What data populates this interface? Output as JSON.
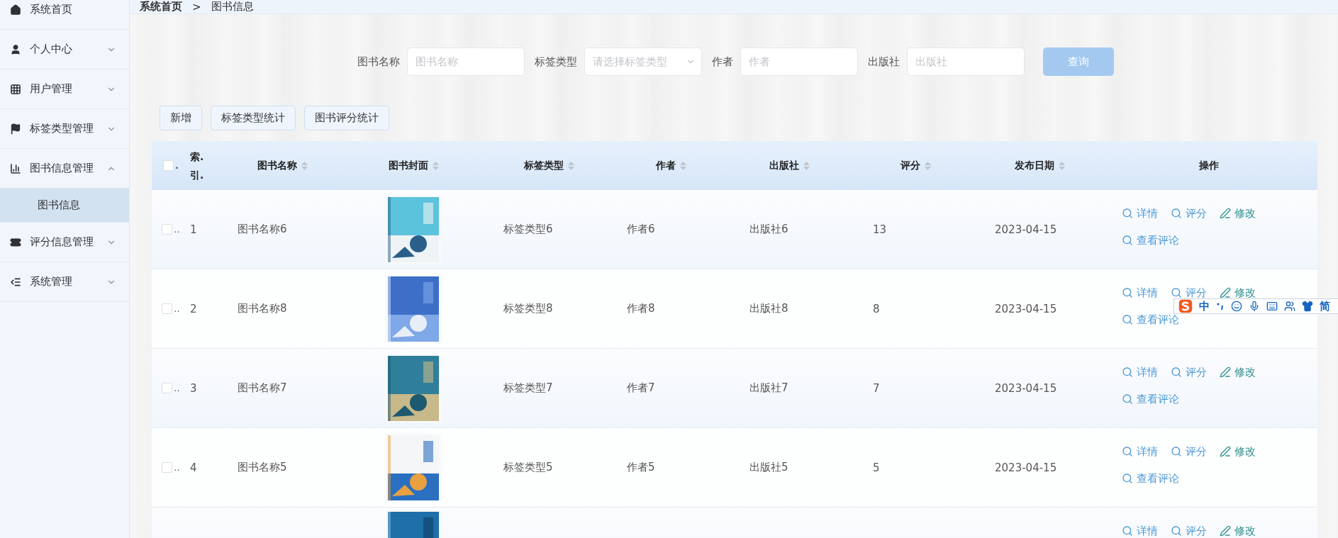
{
  "sidebar": {
    "items": [
      {
        "label": "系统首页"
      },
      {
        "label": "个人中心",
        "expanded": false
      },
      {
        "label": "用户管理",
        "expanded": false
      },
      {
        "label": "标签类型管理",
        "expanded": false
      },
      {
        "label": "图书信息管理",
        "expanded": true,
        "children": [
          {
            "label": "图书信息",
            "selected": true
          }
        ]
      },
      {
        "label": "评分信息管理",
        "expanded": false
      },
      {
        "label": "系统管理",
        "expanded": false
      }
    ]
  },
  "breadcrumb": {
    "items": [
      "系统首页",
      "图书信息"
    ],
    "separator": ">"
  },
  "search": {
    "fields": [
      {
        "kind": "input",
        "label": "图书名称",
        "placeholder": "图书名称"
      },
      {
        "kind": "select",
        "label": "标签类型",
        "placeholder": "请选择标签类型"
      },
      {
        "kind": "input",
        "label": "作者",
        "placeholder": "作者"
      },
      {
        "kind": "input",
        "label": "出版社",
        "placeholder": "出版社"
      }
    ],
    "button": {
      "label": "查询",
      "disabled": true
    }
  },
  "actions": [
    "新增",
    "标签类型统计",
    "图书评分统计"
  ],
  "table": {
    "select_all": {
      "checked": false,
      "suffix": "."
    },
    "index_header": [
      "索.",
      "引."
    ],
    "columns": [
      {
        "label": "图书名称",
        "sortable": true
      },
      {
        "label": "图书封面",
        "sortable": true
      },
      {
        "label": "标签类型",
        "sortable": true
      },
      {
        "label": "作者",
        "sortable": true
      },
      {
        "label": "出版社",
        "sortable": true
      },
      {
        "label": "评分",
        "sortable": true
      },
      {
        "label": "发布日期",
        "sortable": true
      },
      {
        "label": "操作",
        "sortable": false
      }
    ],
    "rows": [
      {
        "checked": false,
        "check_suffix": "..",
        "index": "1",
        "name": "图书名称6",
        "cover": {
          "kind": "picture"
        },
        "tag": "标签类型6",
        "author": "作者6",
        "publisher": "出版社6",
        "rating": "13",
        "date": "2023-04-15",
        "ops": [
          [
            "详情",
            "评分",
            "修改"
          ],
          [
            "查看评论"
          ]
        ]
      },
      {
        "checked": false,
        "check_suffix": "..",
        "index": "2",
        "name": "图书名称8",
        "cover": {
          "kind": "picture"
        },
        "tag": "标签类型8",
        "author": "作者8",
        "publisher": "出版社8",
        "rating": "8",
        "date": "2023-04-15",
        "ops": [
          [
            "详情",
            "评分",
            "修改"
          ],
          [
            "查看评论"
          ]
        ]
      },
      {
        "checked": false,
        "check_suffix": "..",
        "index": "3",
        "name": "图书名称7",
        "cover": {
          "kind": "picture"
        },
        "tag": "标签类型7",
        "author": "作者7",
        "publisher": "出版社7",
        "rating": "7",
        "date": "2023-04-15",
        "ops": [
          [
            "详情",
            "评分",
            "修改"
          ],
          [
            "查看评论"
          ]
        ]
      },
      {
        "checked": false,
        "check_suffix": "..",
        "index": "4",
        "name": "图书名称5",
        "cover": {
          "kind": "picture"
        },
        "tag": "标签类型5",
        "author": "作者5",
        "publisher": "出版社5",
        "rating": "5",
        "date": "2023-04-15",
        "ops": [
          [
            "详情",
            "评分",
            "修改"
          ],
          [
            "查看评论"
          ]
        ]
      },
      {
        "cover": {
          "kind": "picture"
        },
        "ops": [
          [
            "详情",
            "评分",
            "修改"
          ]
        ]
      }
    ]
  },
  "ime_toolbar": {
    "mode": "中",
    "script": "简"
  }
}
